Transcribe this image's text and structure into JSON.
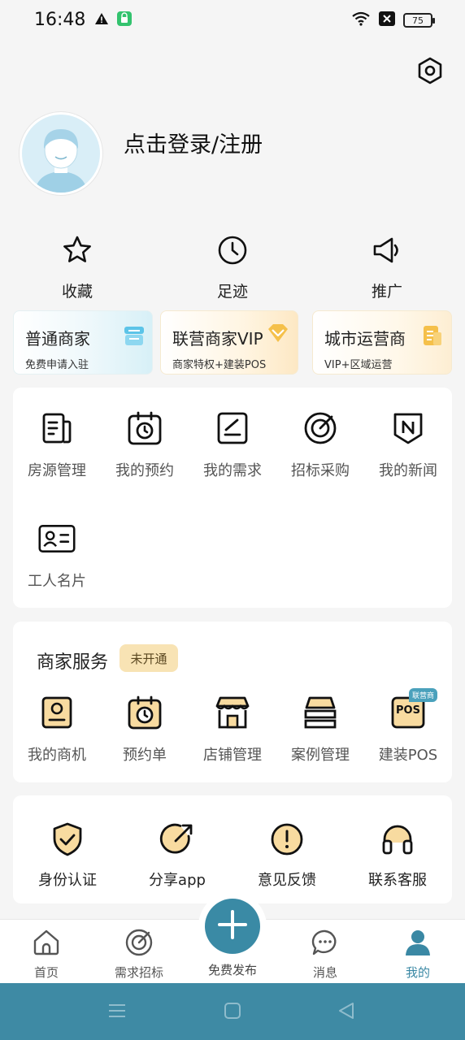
{
  "status_bar": {
    "time": "16:48",
    "battery": "75"
  },
  "profile": {
    "login_text": "点击登录/注册"
  },
  "quick_actions": [
    {
      "label": "收藏",
      "icon": "star-icon"
    },
    {
      "label": "足迹",
      "icon": "clock-icon"
    },
    {
      "label": "推广",
      "icon": "megaphone-icon"
    }
  ],
  "merchant_cards": [
    {
      "title": "普通商家",
      "subtitle": "免费申请入驻",
      "icon": "store-icon"
    },
    {
      "title": "联营商家VIP",
      "subtitle": "商家特权+建装POS",
      "icon": "diamond-icon"
    },
    {
      "title": "城市运营商",
      "subtitle": "VIP+区域运营",
      "icon": "document-icon"
    }
  ],
  "tools": [
    {
      "label": "房源管理",
      "icon": "building-icon"
    },
    {
      "label": "我的预约",
      "icon": "calendar-clock-icon"
    },
    {
      "label": "我的需求",
      "icon": "edit-icon"
    },
    {
      "label": "招标采购",
      "icon": "target-icon"
    },
    {
      "label": "我的新闻",
      "icon": "news-icon"
    },
    {
      "label": "工人名片",
      "icon": "id-card-icon"
    }
  ],
  "merchant_service": {
    "title": "商家服务",
    "badge": "未开通",
    "pos_tag": "联营商",
    "pos_text": "POS",
    "items": [
      {
        "label": "我的商机",
        "icon": "portrait-icon"
      },
      {
        "label": "预约单",
        "icon": "calendar-clock-icon"
      },
      {
        "label": "店铺管理",
        "icon": "shop-icon"
      },
      {
        "label": "案例管理",
        "icon": "stack-icon"
      },
      {
        "label": "建装POS",
        "icon": "pos-icon"
      }
    ]
  },
  "services": [
    {
      "label": "身份认证",
      "icon": "shield-check-icon"
    },
    {
      "label": "分享app",
      "icon": "share-icon"
    },
    {
      "label": "意见反馈",
      "icon": "exclamation-icon"
    },
    {
      "label": "联系客服",
      "icon": "headset-icon"
    }
  ],
  "tab_bar": {
    "tabs": [
      {
        "label": "首页",
        "icon": "home-icon"
      },
      {
        "label": "需求招标",
        "icon": "target-icon"
      },
      {
        "label": "免费发布",
        "icon": "plus-icon"
      },
      {
        "label": "消息",
        "icon": "chat-icon"
      },
      {
        "label": "我的",
        "icon": "user-icon"
      }
    ],
    "active": "我的"
  },
  "colors": {
    "accent": "#3a8aa5",
    "gold": "#f5b840",
    "badge_bg": "#f8e3b4"
  }
}
